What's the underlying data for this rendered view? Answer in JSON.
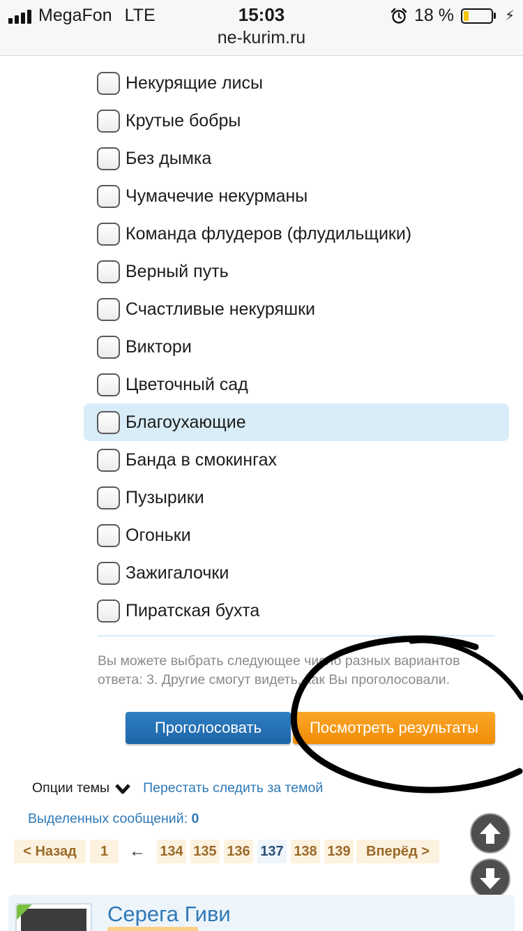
{
  "status_bar": {
    "carrier": "MegaFon",
    "network": "LTE",
    "time": "15:03",
    "url": "ne-kurim.ru",
    "battery_text": "18 %",
    "battery_level": 0.18,
    "icons": [
      "signal-icon",
      "alarm-icon",
      "battery-icon",
      "charging-bolt-icon"
    ]
  },
  "poll": {
    "options": [
      {
        "label": "Некурящие лисы",
        "highlighted": false
      },
      {
        "label": "Крутые бобры",
        "highlighted": false
      },
      {
        "label": "Без дымка",
        "highlighted": false
      },
      {
        "label": "Чумачечие некурманы",
        "highlighted": false
      },
      {
        "label": "Команда флудеров (флудильщики)",
        "highlighted": false
      },
      {
        "label": "Верный путь",
        "highlighted": false
      },
      {
        "label": "Счастливые некуряшки",
        "highlighted": false
      },
      {
        "label": "Виктори",
        "highlighted": false
      },
      {
        "label": "Цветочный сад",
        "highlighted": false
      },
      {
        "label": "Благоухающие",
        "highlighted": true
      },
      {
        "label": "Банда в смокингах",
        "highlighted": false
      },
      {
        "label": "Пузырики",
        "highlighted": false
      },
      {
        "label": "Огоньки",
        "highlighted": false
      },
      {
        "label": "Зажигалочки",
        "highlighted": false
      },
      {
        "label": "Пиратская бухта",
        "highlighted": false
      }
    ],
    "hint": "Вы можете выбрать следующее число разных вариантов ответа: 3. Другие смогут видеть, как Вы проголосовали.",
    "vote_label": "Проголосовать",
    "results_label": "Посмотреть результаты"
  },
  "thread": {
    "options_label": "Опции темы",
    "unfollow_label": "Перестать следить за темой",
    "selected_label": "Выделенных сообщений:",
    "selected_count": "0"
  },
  "pagination": {
    "prev_label": "< Назад",
    "first_page": "1",
    "gap_arrow": "←",
    "pages": [
      "134",
      "135",
      "136",
      "137",
      "138",
      "139"
    ],
    "current_page": "137",
    "next_label": "Вперёд >"
  },
  "post": {
    "author": "Серега Гиви"
  },
  "colors": {
    "link": "#2e79b8",
    "vote_button": "#1d65a8",
    "results_button": "#f18c05",
    "highlight_row": "#d9edf8",
    "annotation_stroke": "#000000"
  }
}
